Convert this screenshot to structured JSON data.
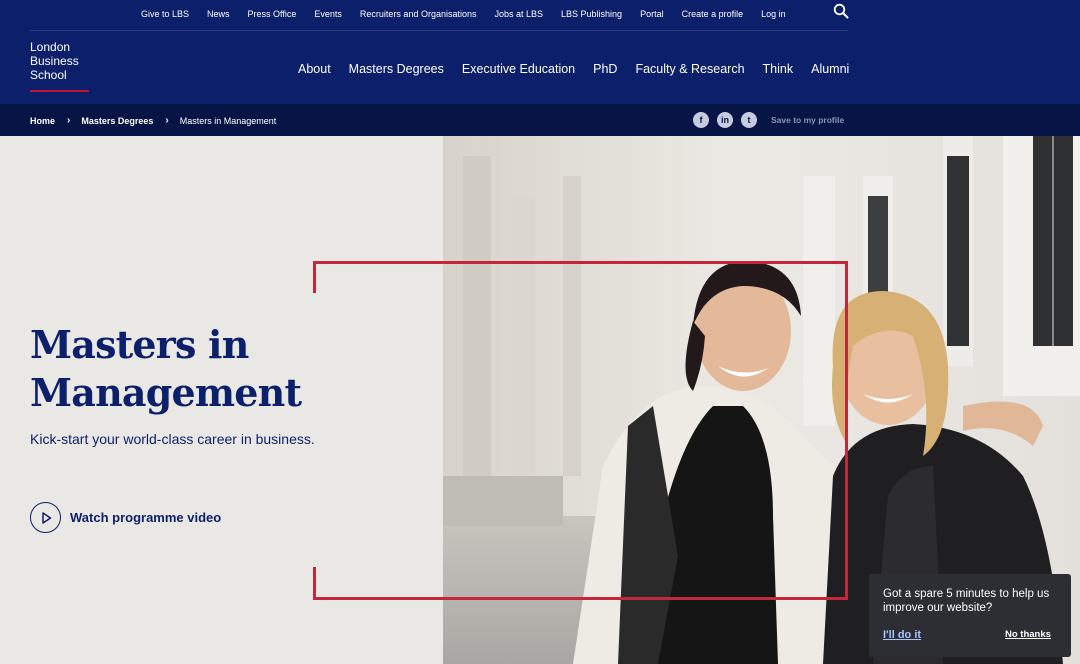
{
  "header": {
    "utility_links": [
      "Give to LBS",
      "News",
      "Press Office",
      "Events",
      "Recruiters and Organisations",
      "Jobs at LBS",
      "LBS Publishing",
      "Portal",
      "Create a profile",
      "Log in"
    ],
    "logo": {
      "line1": "London",
      "line2": "Business",
      "line3": "School"
    },
    "main_nav": [
      "About",
      "Masters Degrees",
      "Executive Education",
      "PhD",
      "Faculty & Research",
      "Think",
      "Alumni"
    ]
  },
  "breadcrumb": {
    "items": [
      "Home",
      "Masters Degrees"
    ],
    "current": "Masters in Management",
    "save_label": "Save to my profile",
    "social": {
      "facebook": "f",
      "linkedin": "in",
      "twitter": "t"
    }
  },
  "hero": {
    "title_line1": "Masters in",
    "title_line2": "Management",
    "subtitle": "Kick-start your world-class career in business.",
    "video_label": "Watch programme video"
  },
  "survey": {
    "message": "Got a spare 5 minutes to help us improve our website?",
    "accept_label": "I'll do it",
    "decline_label": "No thanks"
  },
  "colors": {
    "brand_navy": "#0c1f6b",
    "crumb_bar": "#061546",
    "accent_red": "#c4263b",
    "hero_bg": "#eae8e4"
  }
}
